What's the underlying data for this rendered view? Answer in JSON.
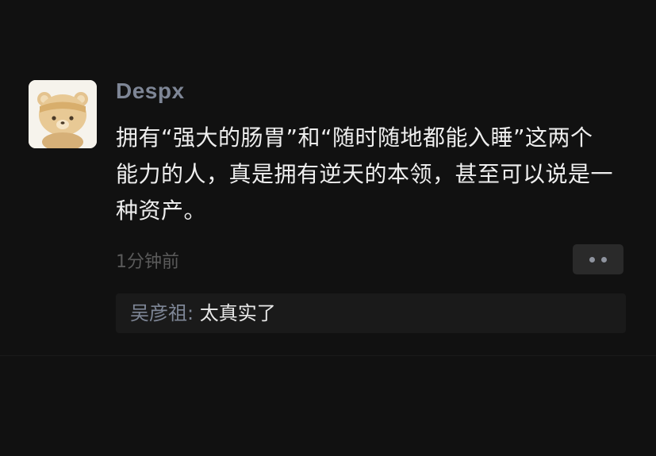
{
  "post": {
    "username": "Despx",
    "content": "拥有“强大的肠胃”和“随时随地都能入睡”这两个能力的人，真是拥有逆天的本领，甚至可以说是一种资产。",
    "timestamp": "1分钟前"
  },
  "reply": {
    "author": "吴彦祖",
    "separator": ": ",
    "text": "太真实了"
  },
  "icons": {
    "avatar": "bear-avatar-icon",
    "more": "more-dots-icon"
  },
  "colors": {
    "background": "#111111",
    "username": "#7e8696",
    "content": "#eeeeee",
    "timestamp": "#5a5a5a",
    "reply_bg": "#1a1a1a"
  }
}
